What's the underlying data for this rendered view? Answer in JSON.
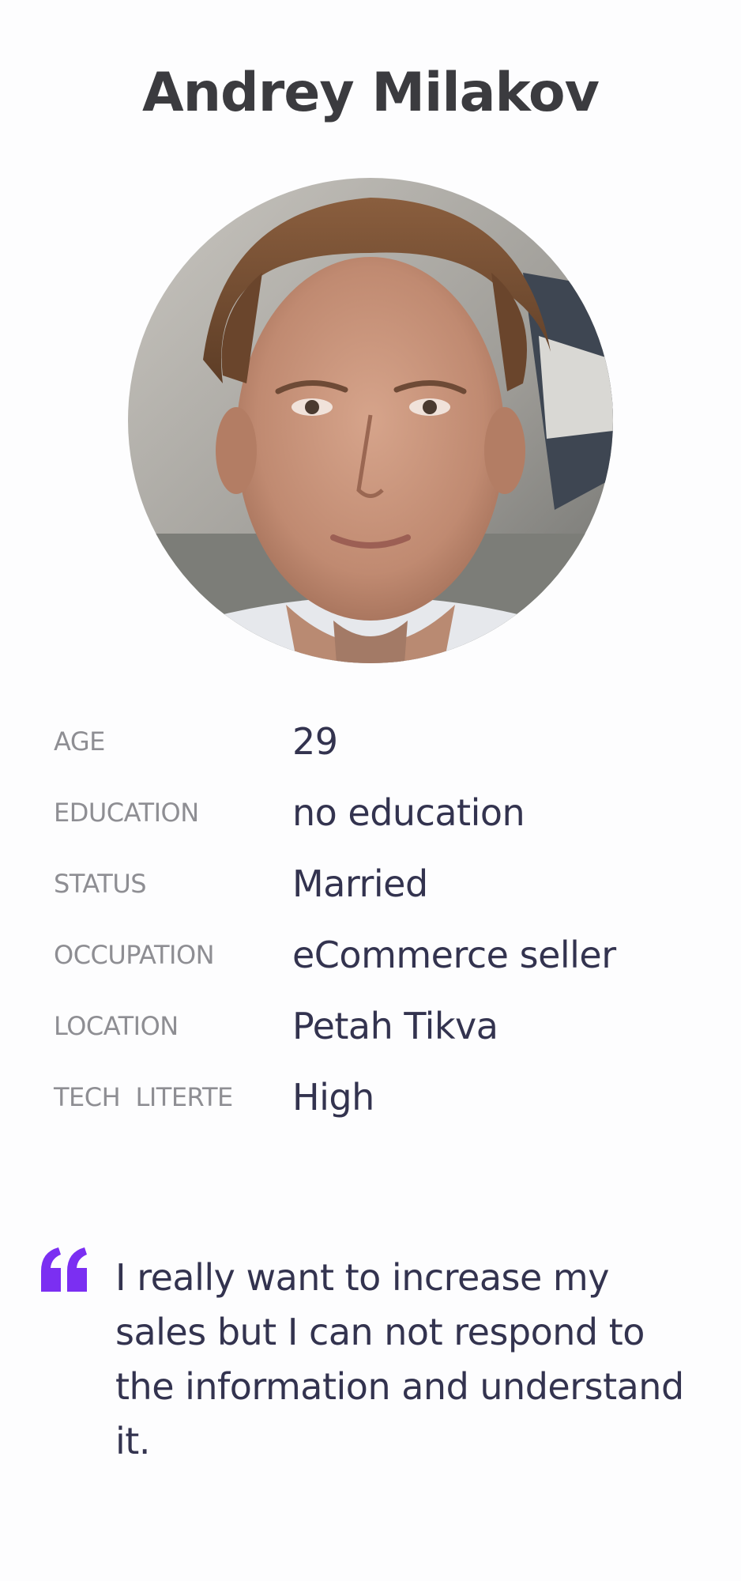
{
  "persona": {
    "name": "Andrey Milakov"
  },
  "details": [
    {
      "label": "AGE",
      "value": "29"
    },
    {
      "label": "EDUCATION",
      "value": "no education"
    },
    {
      "label": "STATUS",
      "value": "Married"
    },
    {
      "label": "OCCUPATION",
      "value": "eCommerce seller"
    },
    {
      "label": "LOCATION",
      "value": "Petah Tikva"
    },
    {
      "label": "TECH  LITERTE",
      "value": "High"
    }
  ],
  "quote": {
    "text": "I really want to increase my sales but I can not respond to the information and understand it.",
    "icon": "quote-icon",
    "accent_color": "#7b2ff2"
  },
  "colors": {
    "name": "#3b3b3f",
    "label": "#8e8e93",
    "value": "#33334f"
  }
}
